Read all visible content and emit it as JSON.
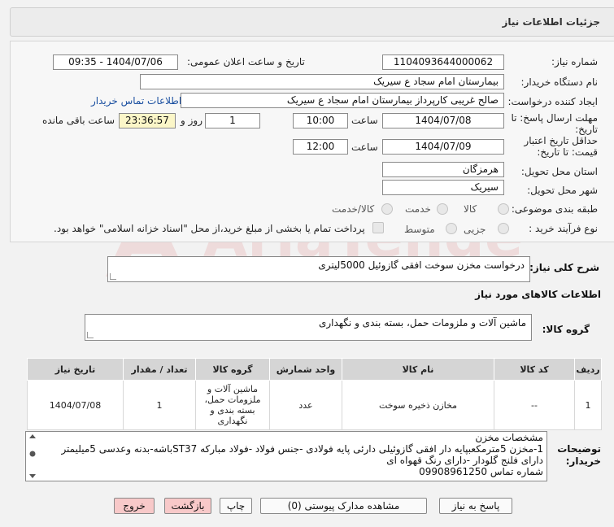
{
  "header": {
    "title": "جزئیات اطلاعات نیاز"
  },
  "form": {
    "need_number_label": "شماره نیاز:",
    "need_number": "1104093644000062",
    "announce_label": "تاریخ و ساعت اعلان عمومی:",
    "announce_value": "1404/07/06 - 09:35",
    "buyer_label": "نام دستگاه خریدار:",
    "buyer_value": "بیمارستان امام سجاد  ع  سیریک",
    "creator_label": "ایجاد کننده درخواست:",
    "creator_value": "صالح غریبی کارپرداز بیمارستان امام سجاد  ع  سیریک",
    "contact_link": "اطلاعات تماس خریدار",
    "deadline_label_1": "مهلت ارسال پاسخ: تا",
    "deadline_label_2": "تاریخ:",
    "deadline_date": "1404/07/08",
    "time_label": "ساعت",
    "deadline_time": "10:00",
    "days_value": "1",
    "days_label": "روز و",
    "remaining_time": "23:36:57",
    "remaining_label": "ساعت باقی مانده",
    "validity_label_1": "حداقل تاریخ اعتبار",
    "validity_label_2": "قیمت: تا تاریخ:",
    "validity_date": "1404/07/09",
    "validity_time": "12:00",
    "province_label": "استان محل تحویل:",
    "province_value": "هرمزگان",
    "city_label": "شهر محل تحویل:",
    "city_value": "سیریک",
    "category_label": "طبقه بندی موضوعی:",
    "category_options": [
      "کالا",
      "خدمت",
      "کالا/خدمت"
    ],
    "process_label": "نوع فرآیند خرید :",
    "process_options": [
      "جزیی",
      "متوسط"
    ],
    "payment_note": "پرداخت تمام یا بخشی از مبلغ خرید،از محل \"اسناد خزانه اسلامی\" خواهد بود."
  },
  "summary": {
    "label": "شرح کلی نیاز:",
    "value": "درخواست مخزن سوخت افقی گازوئیل 5000لیتری"
  },
  "goods_section": {
    "title": "اطلاعات کالاهای مورد نیاز",
    "group_label": "گروه کالا:",
    "group_value": "ماشین آلات و ملزومات حمل، بسته بندی و نگهداری"
  },
  "table": {
    "headers": [
      "ردیف",
      "کد کالا",
      "نام کالا",
      "واحد شمارش",
      "گروه کالا",
      "تعداد / مقدار",
      "تاریخ نیاز"
    ],
    "rows": [
      [
        "1",
        "--",
        "مخازن ذخیره سوخت",
        "عدد",
        "ماشین آلات و ملزومات حمل، بسته بندی و نگهداری",
        "1",
        "1404/07/08"
      ]
    ]
  },
  "buyer_notes": {
    "label_1": "توضیحات",
    "label_2": "خریدار:",
    "lines": [
      "مشخصات مخزن",
      "1-مخزن 5مترمکعبپایه دار افقی گازوئیلی دارئی پایه فولادی -جنس فولاد -فولاد  مبارکه ST37باشه-بدنه وعدسی 5میلیمتر",
      "دارای فلنج گلودار -دارای رنگ قهواه ای",
      "شماره تماس 09908961250"
    ]
  },
  "buttons": {
    "reply": "پاسخ به نیاز",
    "attachments": "مشاهده مدارک پیوستی (0)",
    "print": "چاپ",
    "back": "بازگشت",
    "exit": "خروج"
  },
  "watermark": {
    "text": "AriaTender.net"
  }
}
